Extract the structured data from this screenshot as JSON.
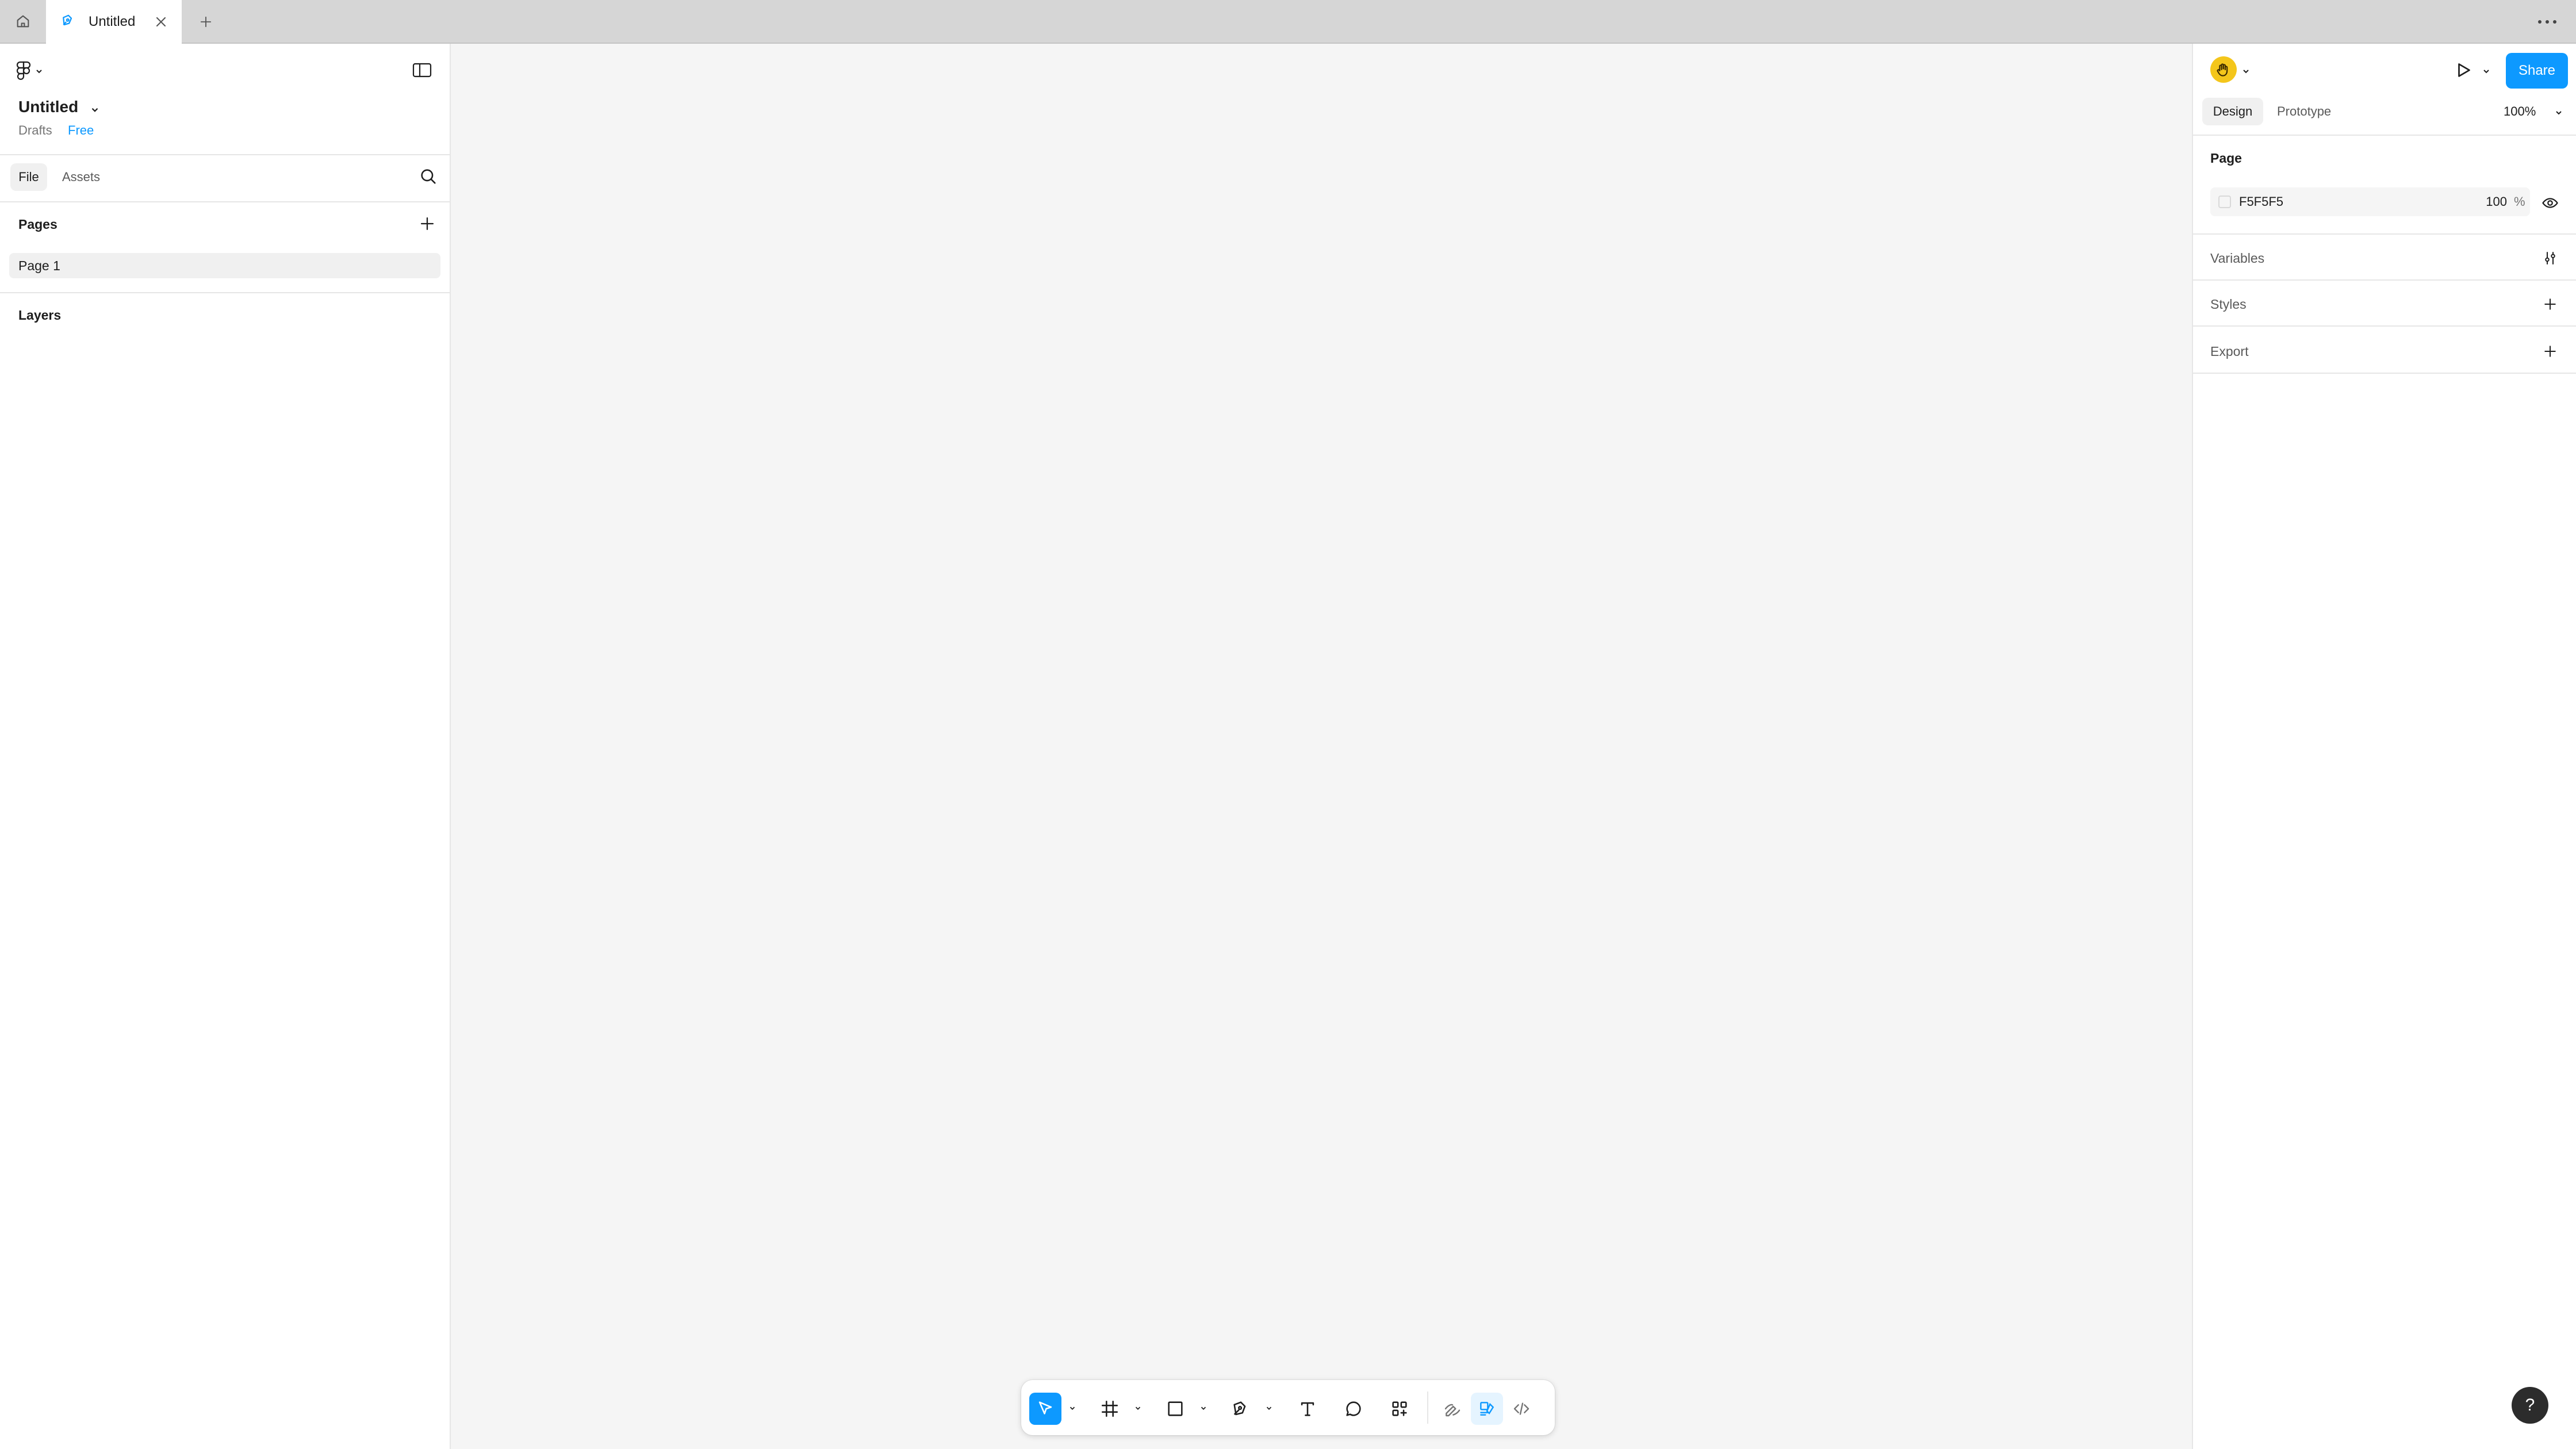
{
  "tabbar": {
    "active_tab_title": "Untitled",
    "icons": [
      "home-icon",
      "design-file-icon",
      "close-icon",
      "plus-icon",
      "more-icon"
    ]
  },
  "left_panel": {
    "file_name": "Untitled",
    "location": "Drafts",
    "plan": "Free",
    "tabs": [
      {
        "label": "File",
        "selected": true
      },
      {
        "label": "Assets",
        "selected": false
      }
    ],
    "pages_heading": "Pages",
    "pages": [
      {
        "name": "Page 1",
        "selected": true
      }
    ],
    "layers_heading": "Layers"
  },
  "right_panel": {
    "share_label": "Share",
    "tabs": [
      {
        "label": "Design",
        "selected": true
      },
      {
        "label": "Prototype",
        "selected": false
      }
    ],
    "zoom": "100%",
    "page_section": {
      "title": "Page",
      "background_hex": "F5F5F5",
      "background_opacity": "100",
      "percent_symbol": "%"
    },
    "sections": [
      {
        "label": "Variables",
        "action_icon": "adjust-icon"
      },
      {
        "label": "Styles",
        "action_icon": "plus-icon"
      },
      {
        "label": "Export",
        "action_icon": "plus-icon"
      }
    ],
    "help_label": "?"
  },
  "toolbar": {
    "tools": [
      "move-tool",
      "frame-tool",
      "rectangle-tool",
      "pen-tool",
      "text-tool",
      "comment-tool",
      "actions-tool"
    ],
    "modes": [
      "draw-mode",
      "design-mode",
      "dev-mode"
    ],
    "active_tool": "move-tool",
    "active_mode": "design-mode"
  },
  "colors": {
    "accent": "#0d99ff",
    "canvas": "#f5f5f5",
    "avatar": "#f4c61b",
    "help_button": "#2c2c2c"
  }
}
